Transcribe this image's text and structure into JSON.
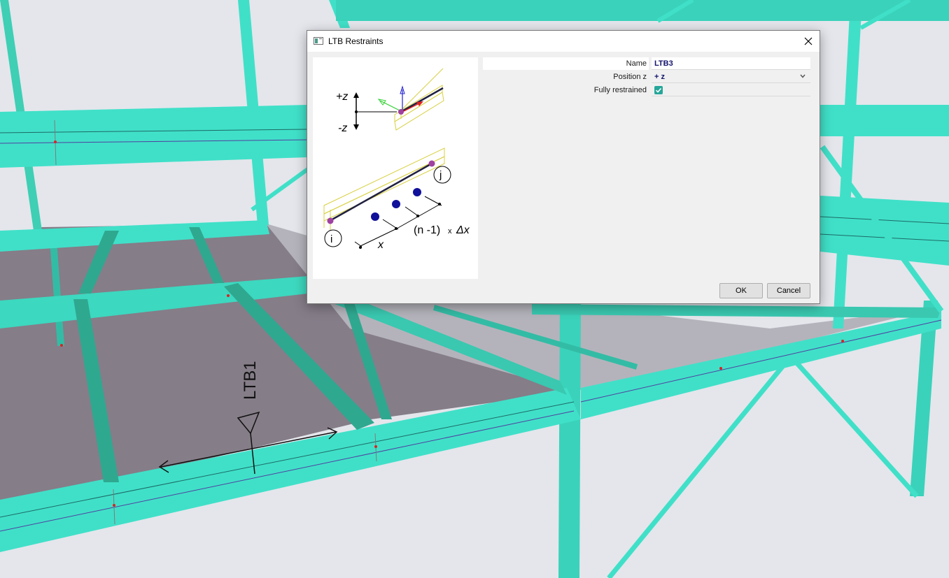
{
  "viewport": {
    "member_label": "LTB1",
    "colors": {
      "background": "#e4e6ec",
      "steel": "#40e0c8",
      "floor": "#8a8290"
    }
  },
  "dialog": {
    "title": "LTB Restraints",
    "icons": {
      "app": "window-icon",
      "close": "close-icon"
    },
    "diagram": {
      "plus_z": "+z",
      "minus_z": "-z",
      "node_i": "i",
      "node_j": "j",
      "spacing_label": "(n -1)",
      "times": "x",
      "delta_x": "Δx",
      "x_label": "x"
    },
    "properties": {
      "name": {
        "label": "Name",
        "value": "LTB3"
      },
      "position": {
        "label": "Position z",
        "value": "+ z"
      },
      "fully_restrained": {
        "label": "Fully restrained",
        "checked": true
      }
    },
    "buttons": {
      "ok": "OK",
      "cancel": "Cancel"
    }
  }
}
